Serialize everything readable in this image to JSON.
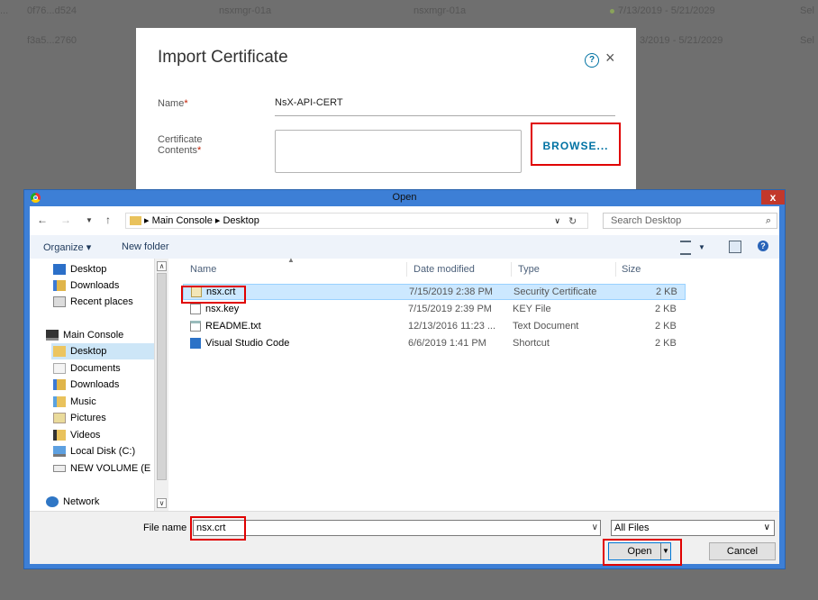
{
  "background_table": {
    "rows": [
      {
        "id": "0f76...d524",
        "c2": "nsxmgr-01a",
        "c3": "nsxmgr-01a",
        "validity": "7/13/2019 - 5/21/2029",
        "c5": "Sel"
      },
      {
        "id": "f3a5...2760",
        "validity_partial": "3/2019 - 5/21/2029",
        "c5": "Sel"
      }
    ],
    "row1_prefix": "..."
  },
  "import_dialog": {
    "title": "Import Certificate",
    "help_icon": "?",
    "close_icon": "×",
    "name_label": "Name",
    "name_value": "NsX-API-CERT",
    "cert_label": "Certificate Contents",
    "required_mark": "*",
    "browse_label": "BROWSE..."
  },
  "open_dialog": {
    "title": "Open",
    "close_label": "x",
    "address_parts": [
      "Main Console",
      "Desktop"
    ],
    "search_placeholder": "Search Desktop",
    "organize_label": "Organize ▾",
    "new_folder_label": "New folder",
    "tree": [
      {
        "label": "Desktop",
        "icon": "desktop-icon"
      },
      {
        "label": "Downloads",
        "icon": "downloads-icon"
      },
      {
        "label": "Recent places",
        "icon": "recent-places-icon"
      },
      {
        "label": "Main Console",
        "icon": "computer-icon"
      },
      {
        "label": "Desktop",
        "icon": "desktop-folder-icon"
      },
      {
        "label": "Documents",
        "icon": "documents-icon"
      },
      {
        "label": "Downloads",
        "icon": "downloads-icon"
      },
      {
        "label": "Music",
        "icon": "music-icon"
      },
      {
        "label": "Pictures",
        "icon": "pictures-icon"
      },
      {
        "label": "Videos",
        "icon": "videos-icon"
      },
      {
        "label": "Local Disk (C:)",
        "icon": "local-disk-icon"
      },
      {
        "label": "NEW VOLUME (E",
        "icon": "drive-icon"
      },
      {
        "label": "Network",
        "icon": "network-icon"
      }
    ],
    "columns": {
      "name": "Name",
      "date": "Date modified",
      "type": "Type",
      "size": "Size"
    },
    "files": [
      {
        "name": "nsx.crt",
        "date": "7/15/2019 2:38 PM",
        "type": "Security Certificate",
        "size": "2 KB"
      },
      {
        "name": "nsx.key",
        "date": "7/15/2019 2:39 PM",
        "type": "KEY File",
        "size": "2 KB"
      },
      {
        "name": "README.txt",
        "date": "12/13/2016 11:23 ...",
        "type": "Text Document",
        "size": "2 KB"
      },
      {
        "name": "Visual Studio Code",
        "date": "6/6/2019 1:41 PM",
        "type": "Shortcut",
        "size": "2 KB"
      }
    ],
    "filename_label": "File name",
    "filename_value": "nsx.crt",
    "filetype_value": "All Files",
    "open_label": "Open",
    "cancel_label": "Cancel"
  },
  "colors": {
    "highlight": "#e00000",
    "accent": "#0072a3",
    "titlebar": "#3d7fd6"
  }
}
